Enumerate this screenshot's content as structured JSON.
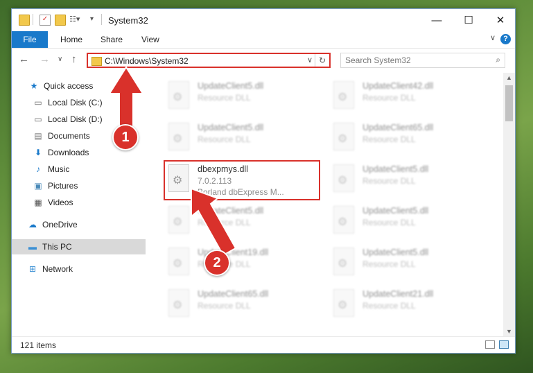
{
  "window": {
    "title": "System32",
    "controls": {
      "minimize": "—",
      "maximize": "☐",
      "close": "✕"
    }
  },
  "ribbon": {
    "file_tab": "File",
    "tabs": [
      "Home",
      "Share",
      "View"
    ],
    "help": "?"
  },
  "address_bar": {
    "path": "C:\\Windows\\System32",
    "refresh": "↻"
  },
  "search": {
    "placeholder": "Search System32"
  },
  "nav_pane": {
    "items": [
      {
        "label": "Quick access",
        "icon": "star-icon",
        "pinned": false
      },
      {
        "label": "Local Disk (C:)",
        "icon": "drive-icon",
        "pinned": true
      },
      {
        "label": "Local Disk (D:)",
        "icon": "drive-icon",
        "pinned": true
      },
      {
        "label": "Documents",
        "icon": "documents-icon",
        "pinned": true
      },
      {
        "label": "Downloads",
        "icon": "download-icon",
        "pinned": true
      },
      {
        "label": "Music",
        "icon": "music-icon",
        "pinned": true
      },
      {
        "label": "Pictures",
        "icon": "pictures-icon",
        "pinned": true
      },
      {
        "label": "Videos",
        "icon": "videos-icon",
        "pinned": true
      },
      {
        "label": "OneDrive",
        "icon": "cloud-icon",
        "pinned": false
      },
      {
        "label": "This PC",
        "icon": "computer-icon",
        "pinned": false,
        "selected": true
      },
      {
        "label": "Network",
        "icon": "network-icon",
        "pinned": false
      }
    ]
  },
  "files": [
    {
      "name": "UpdateClient5.dll",
      "desc": "Resource DLL",
      "blurred": true
    },
    {
      "name": "UpdateClient42.dll",
      "desc": "Resource DLL",
      "blurred": true
    },
    {
      "name": "UpdateClient5.dll",
      "desc": "Resource DLL",
      "blurred": true
    },
    {
      "name": "UpdateClient65.dll",
      "desc": "Resource DLL",
      "blurred": true
    },
    {
      "name": "dbexpmys.dll",
      "version": "7.0.2.113",
      "desc": "Borland dbExpress M...",
      "blurred": false,
      "highlighted": true
    },
    {
      "name": "UpdateClient5.dll",
      "desc": "Resource DLL",
      "blurred": true
    },
    {
      "name": "UpdateClient5.dll",
      "desc": "Resource DLL",
      "blurred": true
    },
    {
      "name": "UpdateClient5.dll",
      "desc": "Resource DLL",
      "blurred": true
    },
    {
      "name": "UpdateClient19.dll",
      "desc": "Resource DLL",
      "blurred": true
    },
    {
      "name": "UpdateClient5.dll",
      "desc": "Resource DLL",
      "blurred": true
    },
    {
      "name": "UpdateClient65.dll",
      "desc": "Resource DLL",
      "blurred": true
    },
    {
      "name": "UpdateClient21.dll",
      "desc": "Resource DLL",
      "blurred": true
    }
  ],
  "status_bar": {
    "item_count": "121 items"
  },
  "callouts": {
    "one": "1",
    "two": "2"
  },
  "colors": {
    "accent": "#1979ca",
    "callout": "#d9312b"
  }
}
